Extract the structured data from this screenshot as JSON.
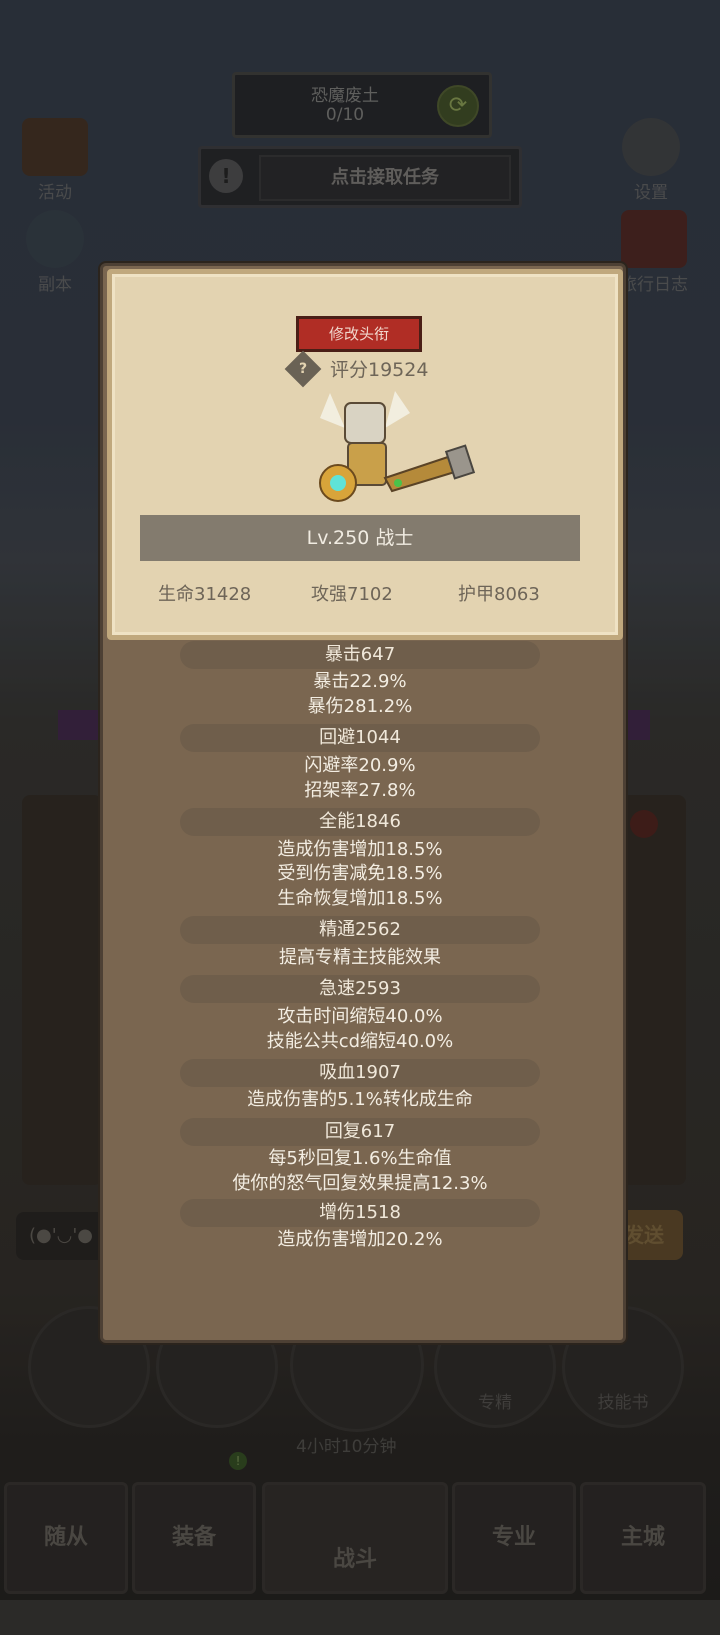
{
  "top": {
    "quest_name": "恐魔废土",
    "quest_progress": "0/10",
    "task_button": "点击接取任务"
  },
  "side": {
    "activity": "活动",
    "dungeon": "副本",
    "settings": "设置",
    "journal": "旅行日志"
  },
  "character": {
    "change_title": "修改头衔",
    "score": "评分19524",
    "level_class": "Lv.250 战士",
    "hp": "生命31428",
    "atk": "攻强7102",
    "armor": "护甲8063"
  },
  "attributes": [
    {
      "header": "暴击647",
      "lines": [
        "暴击22.9%",
        "暴伤281.2%"
      ]
    },
    {
      "header": "回避1044",
      "lines": [
        "闪避率20.9%",
        "招架率27.8%"
      ]
    },
    {
      "header": "全能1846",
      "lines": [
        "造成伤害增加18.5%",
        "受到伤害减免18.5%",
        "生命恢复增加18.5%"
      ]
    },
    {
      "header": "精通2562",
      "lines": [
        "提高专精主技能效果"
      ]
    },
    {
      "header": "急速2593",
      "lines": [
        "攻击时间缩短40.0%",
        "技能公共cd缩短40.0%"
      ]
    },
    {
      "header": "吸血1907",
      "lines": [
        "造成伤害的5.1%转化成生命"
      ]
    },
    {
      "header": "回复617",
      "lines": [
        "每5秒回复1.6%生命值",
        "使你的怒气回复效果提高12.3%"
      ]
    },
    {
      "header": "增伤1518",
      "lines": [
        "造成伤害增加20.2%"
      ]
    }
  ],
  "bottom": {
    "chest_timer": "4小时10分钟",
    "spec": "专精",
    "skillbook": "技能书",
    "emote": "(●'◡'●",
    "send": "发送",
    "chest_badge": "!",
    "equip_badge": "!"
  },
  "nav": {
    "followers": "随从",
    "equipment": "装备",
    "battle": "战斗",
    "profession": "专业",
    "city": "主城"
  },
  "colors": {
    "panel": "#7a6650",
    "card": "#e3d3b1",
    "title_button": "#b02d25"
  }
}
